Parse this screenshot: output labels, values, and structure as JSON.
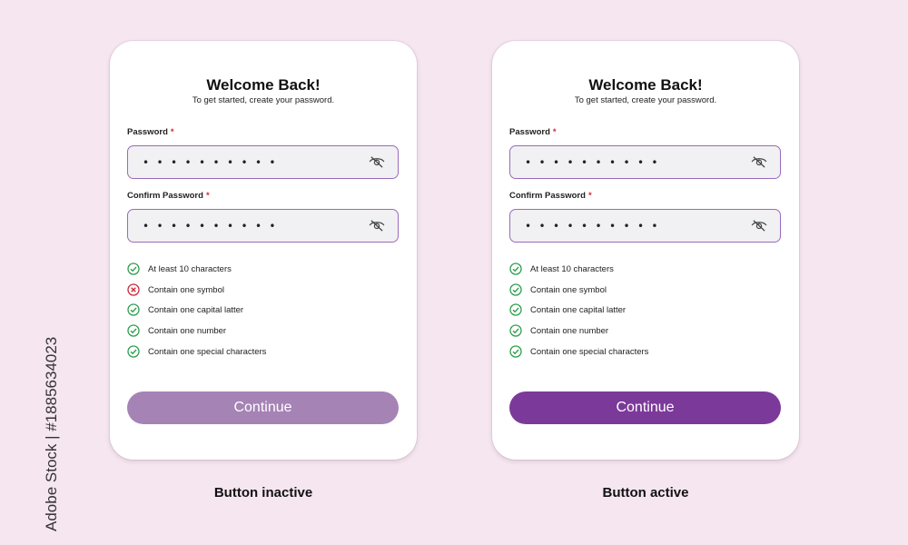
{
  "colors": {
    "background": "#f6e6f0",
    "accent": "#9a6bbd",
    "button_inactive": "#a583b5",
    "button_active": "#7b3a9a",
    "check_ok": "#2e9e4f",
    "check_fail": "#d0283a"
  },
  "cards": [
    {
      "title": "Welcome Back!",
      "subtitle": "To get started, create your password.",
      "password_label": "Password",
      "password_value": "• • • • • • • • • •",
      "confirm_label": "Confirm Password",
      "confirm_value": "• • • • • • • • • •",
      "required_mark": "*",
      "eye_icon": "eye-off-icon",
      "requirements": [
        {
          "label": "At least 10 characters",
          "status": "ok"
        },
        {
          "label": "Contain one symbol",
          "status": "fail"
        },
        {
          "label": "Contain one capital latter",
          "status": "ok"
        },
        {
          "label": "Contain one number",
          "status": "ok"
        },
        {
          "label": "Contain one special characters",
          "status": "ok"
        }
      ],
      "button_label": "Continue",
      "button_state": "inactive",
      "caption": "Button inactive"
    },
    {
      "title": "Welcome Back!",
      "subtitle": "To get started, create your password.",
      "password_label": "Password",
      "password_value": "• • • • • • • • • •",
      "confirm_label": "Confirm Password",
      "confirm_value": "• • • • • • • • • •",
      "required_mark": "*",
      "eye_icon": "eye-off-icon",
      "requirements": [
        {
          "label": "At least 10 characters",
          "status": "ok"
        },
        {
          "label": "Contain one symbol",
          "status": "ok"
        },
        {
          "label": "Contain one capital latter",
          "status": "ok"
        },
        {
          "label": "Contain one number",
          "status": "ok"
        },
        {
          "label": "Contain one special characters",
          "status": "ok"
        }
      ],
      "button_label": "Continue",
      "button_state": "active",
      "caption": "Button active"
    }
  ],
  "watermark": "Adobe Stock | #1885634023"
}
